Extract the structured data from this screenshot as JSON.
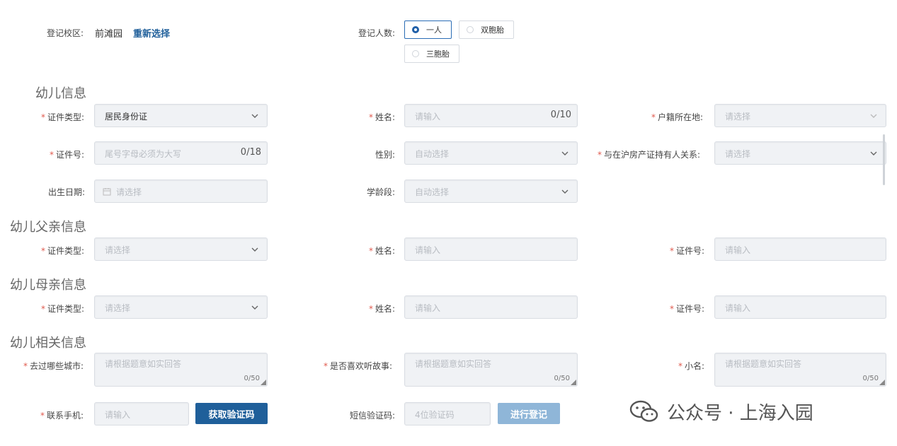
{
  "header": {
    "campus_label": "登记校区:",
    "campus_value": "前滩园",
    "reselect": "重新选择",
    "count_label": "登记人数:",
    "options": [
      "一人",
      "双胞胎",
      "三胞胎"
    ],
    "selected": "一人"
  },
  "sections": {
    "child": "幼儿信息",
    "father": "幼儿父亲信息",
    "mother": "幼儿母亲信息",
    "related": "幼儿相关信息"
  },
  "child": {
    "id_type_label": "证件类型:",
    "id_type_value": "居民身份证",
    "name_label": "姓名:",
    "name_placeholder": "请输入",
    "name_count": "0/10",
    "household_label": "户籍所在地:",
    "household_placeholder": "请选择",
    "id_no_label": "证件号:",
    "id_no_placeholder": "尾号字母必须为大写",
    "id_no_count": "0/18",
    "gender_label": "性别:",
    "gender_placeholder": "自动选择",
    "relation_label": "与在沪房产证持有人关系:",
    "relation_placeholder": "请选择",
    "birth_label": "出生日期:",
    "birth_placeholder": "请选择",
    "age_label": "学龄段:",
    "age_placeholder": "自动选择"
  },
  "father": {
    "id_type_label": "证件类型:",
    "id_type_placeholder": "请选择",
    "name_label": "姓名:",
    "name_placeholder": "请输入",
    "id_no_label": "证件号:",
    "id_no_placeholder": "请输入"
  },
  "mother": {
    "id_type_label": "证件类型:",
    "id_type_placeholder": "请选择",
    "name_label": "姓名:",
    "name_placeholder": "请输入",
    "id_no_label": "证件号:",
    "id_no_placeholder": "请输入"
  },
  "related": {
    "cities_label": "去过哪些城市:",
    "cities_placeholder": "请根据题意如实回答",
    "cities_count": "0/50",
    "story_label": "是否喜欢听故事:",
    "story_placeholder": "请根据题意如实回答",
    "story_count": "0/50",
    "nickname_label": "小名:",
    "nickname_placeholder": "请根据题意如实回答",
    "nickname_count": "0/50",
    "phone_label": "联系手机:",
    "phone_placeholder": "请输入",
    "get_code": "获取验证码",
    "sms_label": "短信验证码:",
    "sms_placeholder": "4位验证码",
    "submit": "进行登记"
  },
  "watermark": "公众号 · 上海入园",
  "icons": [
    "radio-icon",
    "chevron-down-icon",
    "calendar-icon",
    "wechat-icon",
    "resize-grip-icon"
  ],
  "colors": {
    "primary": "#1f5f9a",
    "required": "#e05a4e",
    "field_bg": "#f0f2f5"
  }
}
